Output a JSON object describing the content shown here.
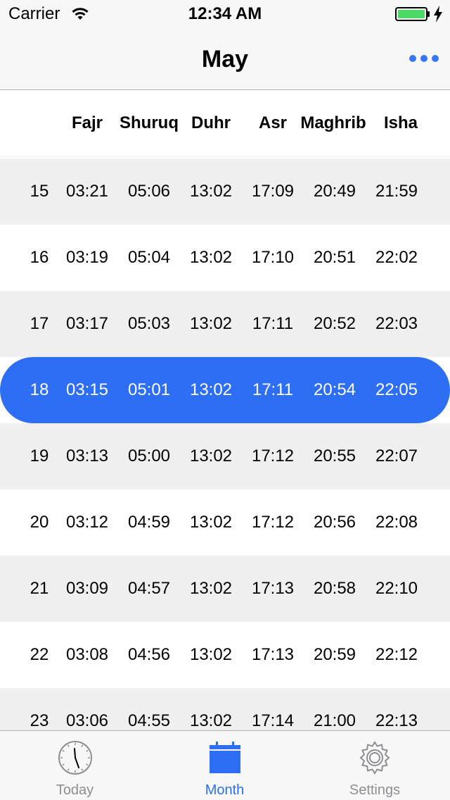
{
  "status_bar": {
    "carrier": "Carrier",
    "time": "12:34 AM"
  },
  "nav": {
    "title": "May"
  },
  "columns": [
    "",
    "Fajr",
    "Shuruq",
    "Duhr",
    "Asr",
    "Maghrib",
    "Isha"
  ],
  "rows": [
    {
      "day": "15",
      "fajr": "03:21",
      "shuruq": "05:06",
      "duhr": "13:02",
      "asr": "17:09",
      "maghrib": "20:49",
      "isha": "21:59"
    },
    {
      "day": "16",
      "fajr": "03:19",
      "shuruq": "05:04",
      "duhr": "13:02",
      "asr": "17:10",
      "maghrib": "20:51",
      "isha": "22:02"
    },
    {
      "day": "17",
      "fajr": "03:17",
      "shuruq": "05:03",
      "duhr": "13:02",
      "asr": "17:11",
      "maghrib": "20:52",
      "isha": "22:03"
    },
    {
      "day": "18",
      "fajr": "03:15",
      "shuruq": "05:01",
      "duhr": "13:02",
      "asr": "17:11",
      "maghrib": "20:54",
      "isha": "22:05"
    },
    {
      "day": "19",
      "fajr": "03:13",
      "shuruq": "05:00",
      "duhr": "13:02",
      "asr": "17:12",
      "maghrib": "20:55",
      "isha": "22:07"
    },
    {
      "day": "20",
      "fajr": "03:12",
      "shuruq": "04:59",
      "duhr": "13:02",
      "asr": "17:12",
      "maghrib": "20:56",
      "isha": "22:08"
    },
    {
      "day": "21",
      "fajr": "03:09",
      "shuruq": "04:57",
      "duhr": "13:02",
      "asr": "17:13",
      "maghrib": "20:58",
      "isha": "22:10"
    },
    {
      "day": "22",
      "fajr": "03:08",
      "shuruq": "04:56",
      "duhr": "13:02",
      "asr": "17:13",
      "maghrib": "20:59",
      "isha": "22:12"
    },
    {
      "day": "23",
      "fajr": "03:06",
      "shuruq": "04:55",
      "duhr": "13:02",
      "asr": "17:14",
      "maghrib": "21:00",
      "isha": "22:13"
    }
  ],
  "selected_day": "18",
  "tabs": [
    {
      "label": "Today",
      "icon": "clock-icon",
      "active": false
    },
    {
      "label": "Month",
      "icon": "calendar-icon",
      "active": true
    },
    {
      "label": "Settings",
      "icon": "gear-icon",
      "active": false
    }
  ],
  "colors": {
    "accent": "#2d6ef5",
    "row_stripe": "#efefef",
    "bar_background": "#f7f7f7",
    "battery": "#4cd964"
  }
}
